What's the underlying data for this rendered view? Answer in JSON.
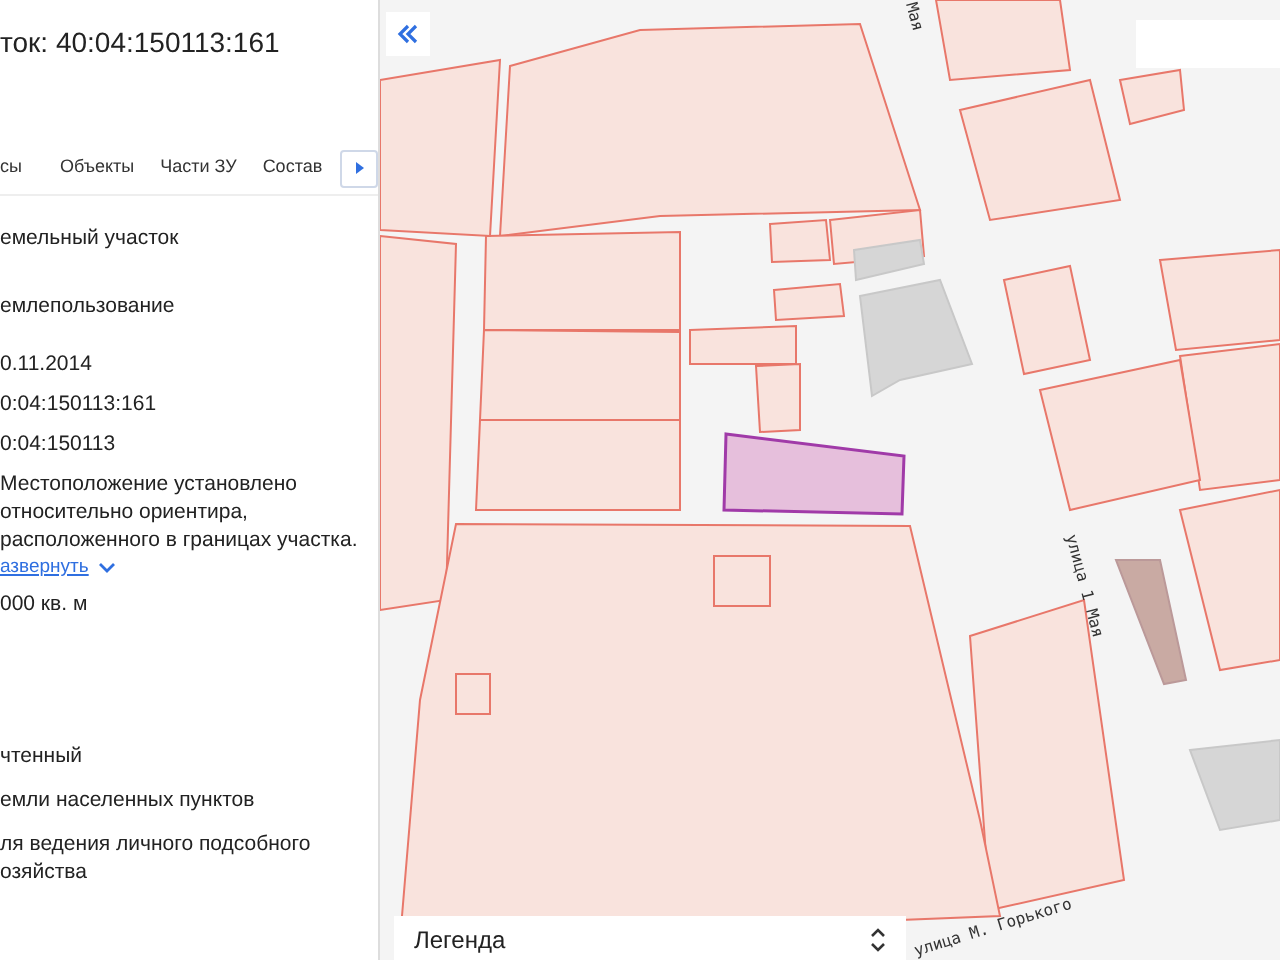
{
  "panel": {
    "title": "ток: 40:04:150113:161",
    "tabs": [
      {
        "label": "сы",
        "selected": false
      },
      {
        "label": "Объекты",
        "selected": false
      },
      {
        "label": "Части ЗУ",
        "selected": false
      },
      {
        "label": "Состав",
        "selected": false
      }
    ],
    "fields": [
      {
        "kind": "text",
        "value": "емельный участок"
      },
      {
        "kind": "text",
        "value": "емлепользование"
      },
      {
        "kind": "text",
        "value": "0.11.2014"
      },
      {
        "kind": "text",
        "value": "0:04:150113:161"
      },
      {
        "kind": "text",
        "value": "0:04:150113"
      },
      {
        "kind": "expandable",
        "value": "Местоположение установлено относительно ориентира, расположенного в границах участка.",
        "link": "азвернуть"
      },
      {
        "kind": "text",
        "value": "000 кв. м"
      },
      {
        "kind": "text",
        "value": "чтенный"
      },
      {
        "kind": "text",
        "value": "емли населенных пунктов"
      },
      {
        "kind": "text",
        "value": "ля ведения личного подсобного озяйства"
      }
    ]
  },
  "map": {
    "streets": [
      "Мая",
      "улица 1 Мая",
      "улица М. Горького"
    ],
    "legend": "Легенда"
  }
}
